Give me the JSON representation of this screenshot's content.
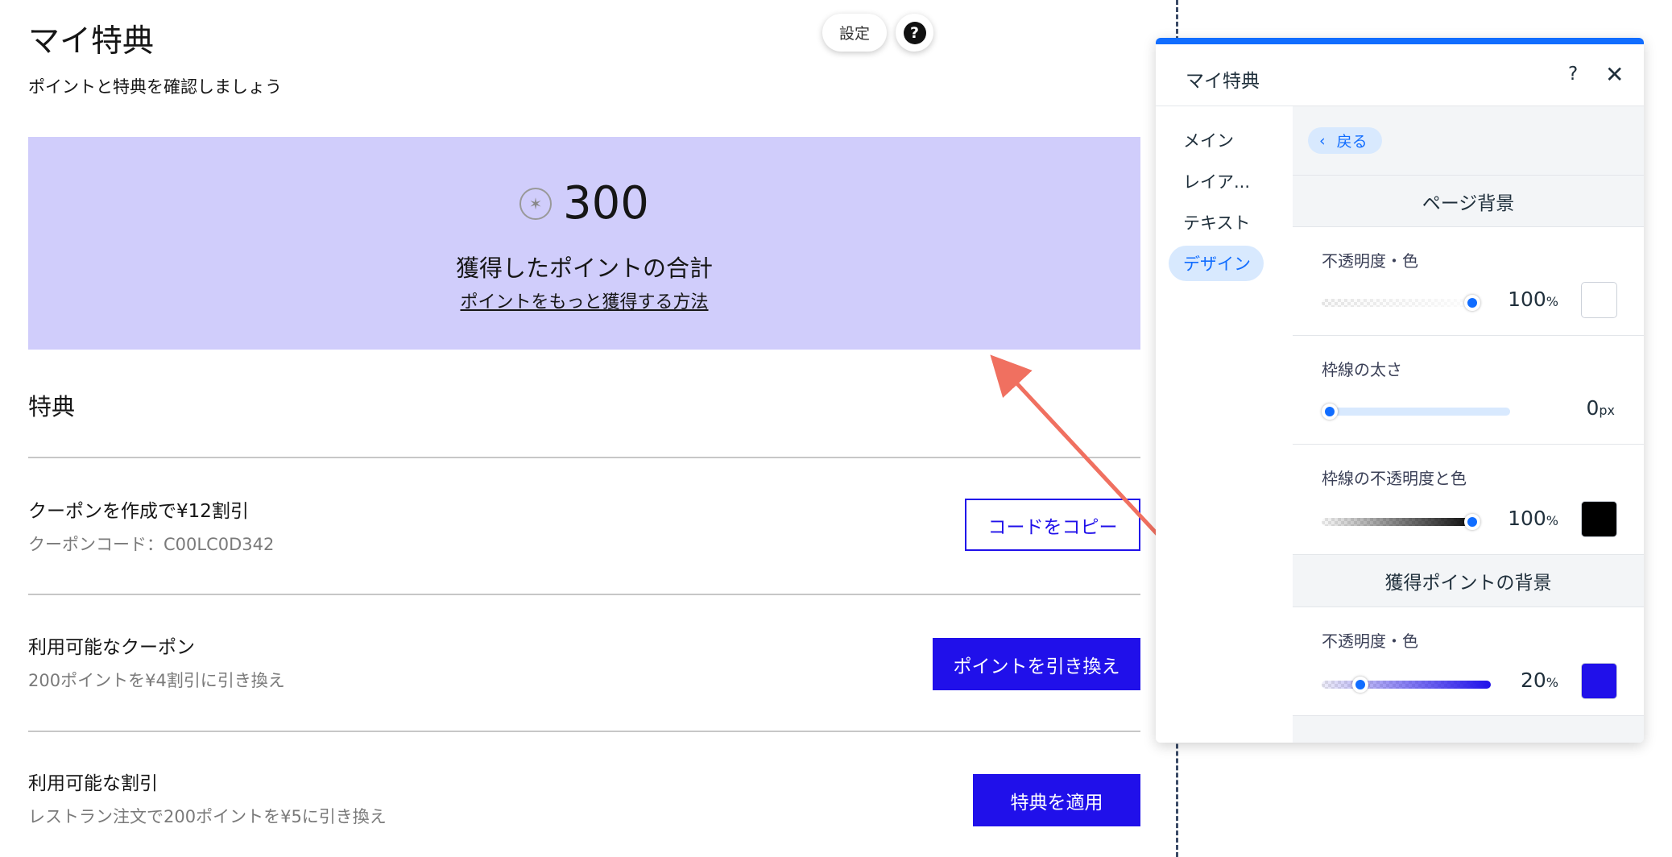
{
  "page": {
    "title": "マイ特典",
    "subtitle": "ポイントと特典を確認しましょう",
    "settings_button": "設定",
    "help_button": "?",
    "points_card": {
      "points_icon": "star-coin-icon",
      "points_value": "300",
      "points_label": "獲得したポイントの合計",
      "how_to_earn_link": "ポイントをもっと獲得する方法",
      "background_color": "#d0cdfb"
    },
    "rewards_heading": "特典",
    "rewards": [
      {
        "title": "クーポンを作成で¥12割引",
        "description": "クーポンコード：C00LC0D342",
        "button": "コードをコピー",
        "button_style": "outline"
      },
      {
        "title": "利用可能なクーポン",
        "description": "200ポイントを¥4割引に引き換え",
        "button": "ポイントを引き換え",
        "button_style": "solid"
      },
      {
        "title": "利用可能な割引",
        "description": "レストラン注文で200ポイントを¥5に引き換え",
        "button": "特典を適用",
        "button_style": "solid"
      }
    ],
    "accent_color": "#2010ea"
  },
  "panel": {
    "title": "マイ特典",
    "help_icon": "?",
    "close_icon": "✕",
    "nav": [
      "メイン",
      "レイア...",
      "テキスト",
      "デザイン"
    ],
    "active_nav": "デザイン",
    "back_label": "戻る",
    "back_icon": "‹",
    "sections": {
      "page_background": {
        "heading": "ページ背景",
        "opacity_label": "不透明度・色",
        "opacity_value": "100",
        "opacity_unit": "%",
        "opacity_fraction": 1.0,
        "color": "#ffffff",
        "border_width_label": "枠線の太さ",
        "border_width_value": "0",
        "border_width_unit": "px",
        "border_width_fraction": 0.0,
        "border_opacity_label": "枠線の不透明度と色",
        "border_opacity_value": "100",
        "border_opacity_unit": "%",
        "border_opacity_fraction": 1.0,
        "border_color": "#000000"
      },
      "points_background": {
        "heading": "獲得ポイントの背景",
        "opacity_label": "不透明度・色",
        "opacity_value": "20",
        "opacity_unit": "%",
        "opacity_fraction": 0.2,
        "color": "#2010ea"
      }
    },
    "accent_color": "#116dff"
  },
  "annotation_arrow_color": "#f07060"
}
